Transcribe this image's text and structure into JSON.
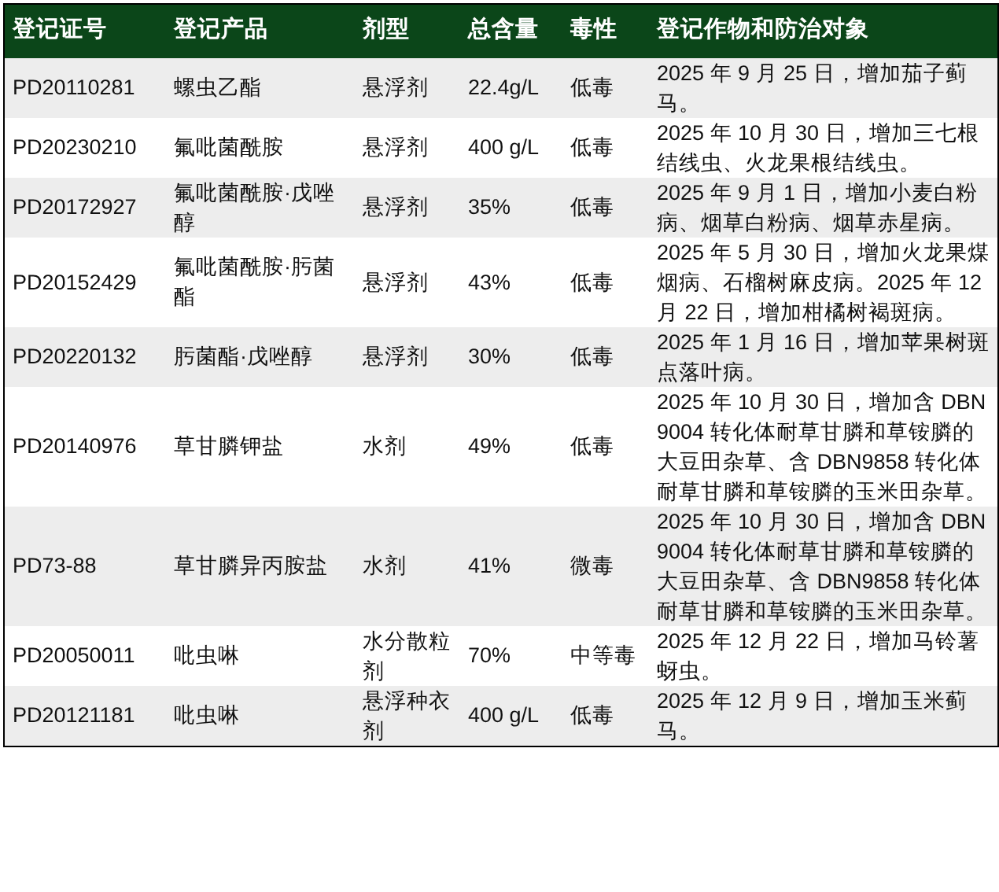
{
  "table": {
    "columns": [
      "登记证号",
      "登记产品",
      "剂型",
      "总含量",
      "毒性",
      "登记作物和防治对象"
    ],
    "rows": [
      [
        "PD20110281",
        "螺虫乙酯",
        "悬浮剂",
        "22.4g/L",
        "低毒",
        "2025 年 9 月 25 日，增加茄子蓟马。"
      ],
      [
        "PD20230210",
        "氟吡菌酰胺",
        "悬浮剂",
        "400 g/L",
        "低毒",
        "2025 年 10 月 30 日，增加三七根结线虫、火龙果根结线虫。"
      ],
      [
        "PD20172927",
        "氟吡菌酰胺·戊唑醇",
        "悬浮剂",
        "35%",
        "低毒",
        "2025 年 9 月 1 日，增加小麦白粉病、烟草白粉病、烟草赤星病。"
      ],
      [
        "PD20152429",
        "氟吡菌酰胺·肟菌酯",
        "悬浮剂",
        "43%",
        "低毒",
        "2025 年 5 月 30 日，增加火龙果煤烟病、石榴树麻皮病。2025 年 12 月 22 日，增加柑橘树褐斑病。"
      ],
      [
        "PD20220132",
        "肟菌酯·戊唑醇",
        "悬浮剂",
        "30%",
        "低毒",
        "2025 年 1 月 16 日，增加苹果树斑点落叶病。"
      ],
      [
        "PD20140976",
        "草甘膦钾盐",
        "水剂",
        "49%",
        "低毒",
        "2025 年 10 月 30 日，增加含 DBN9004 转化体耐草甘膦和草铵膦的大豆田杂草、含 DBN9858 转化体耐草甘膦和草铵膦的玉米田杂草。"
      ],
      [
        "PD73-88",
        "草甘膦异丙胺盐",
        "水剂",
        "41%",
        "微毒",
        "2025 年 10 月 30 日，增加含 DBN9004 转化体耐草甘膦和草铵膦的大豆田杂草、含 DBN9858 转化体耐草甘膦和草铵膦的玉米田杂草。"
      ],
      [
        "PD20050011",
        "吡虫啉",
        "水分散粒剂",
        "70%",
        "中等毒",
        "2025 年 12 月 22 日，增加马铃薯蚜虫。"
      ],
      [
        "PD20121181",
        "吡虫啉",
        "悬浮种衣剂",
        "400 g/L",
        "低毒",
        "2025 年 12 月 9 日，增加玉米蓟马。"
      ]
    ]
  }
}
